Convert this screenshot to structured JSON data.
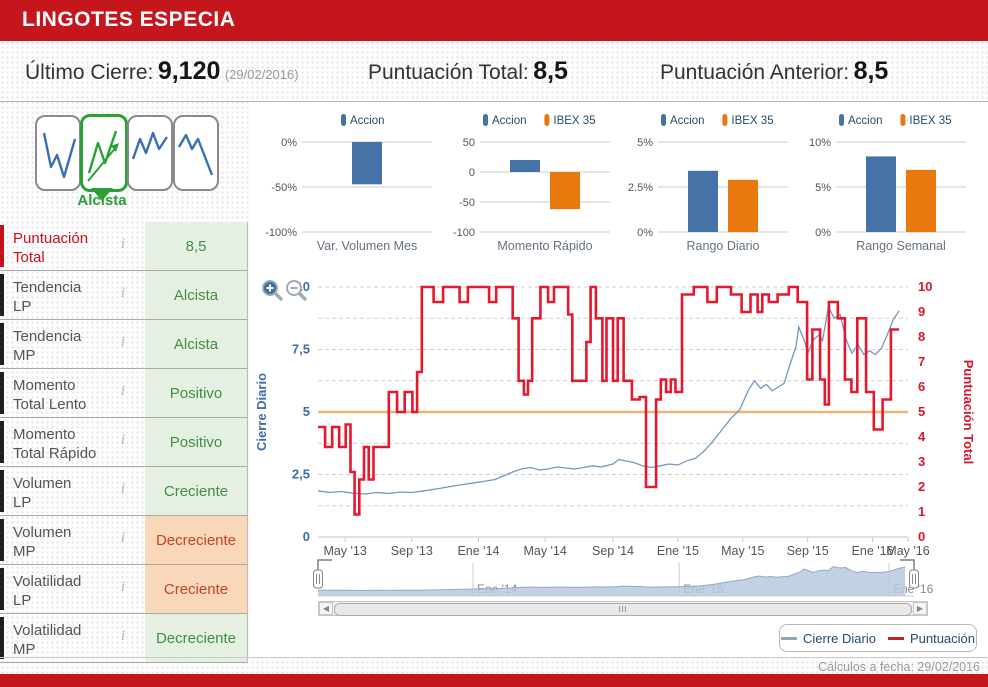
{
  "header": {
    "title": "LINGOTES ESPECIA"
  },
  "stats": {
    "last_close": {
      "label": "Último Cierre:",
      "value": "9,120",
      "date": "(29/02/2016)"
    },
    "score_total": {
      "label": "Puntuación Total:",
      "value": "8,5"
    },
    "score_prev": {
      "label": "Puntuación Anterior:",
      "value": "8,5"
    }
  },
  "colors": {
    "accent_red": "#c4161c",
    "bar_blue": "#4572a7",
    "bar_orange": "#e8790d",
    "series_blue": "#7596bd",
    "series_red": "#e6182e",
    "threshold_orange": "#f0b377",
    "good_bg": "#e6f0e2",
    "good_text": "#3e9044",
    "bad_bg": "#f9d8ba",
    "bad_text": "#c6402c",
    "axis_blue": "#3c6da8",
    "axis_red": "#d6182b",
    "legend_text": "#274b6d"
  },
  "trend_selector": {
    "selected_label": "Alcista",
    "icons": [
      {
        "name": "bajista",
        "selected": false
      },
      {
        "name": "alcista",
        "selected": true
      },
      {
        "name": "lateral-alcista",
        "selected": false
      },
      {
        "name": "lateral-bajista",
        "selected": false
      }
    ]
  },
  "indicators": [
    {
      "line1": "Puntuación",
      "line2": "Total",
      "value": "8,5",
      "state": "good",
      "highlight": true
    },
    {
      "line1": "Tendencia",
      "line2": "LP",
      "value": "Alcista",
      "state": "good"
    },
    {
      "line1": "Tendencia",
      "line2": "MP",
      "value": "Alcista",
      "state": "good"
    },
    {
      "line1": "Momento",
      "line2": "Total Lento",
      "value": "Positivo",
      "state": "good"
    },
    {
      "line1": "Momento",
      "line2": "Total Rápido",
      "value": "Positivo",
      "state": "good"
    },
    {
      "line1": "Volumen",
      "line2": "LP",
      "value": "Creciente",
      "state": "good"
    },
    {
      "line1": "Volumen",
      "line2": "MP",
      "value": "Decreciente",
      "state": "bad"
    },
    {
      "line1": "Volatilidad",
      "line2": "LP",
      "value": "Creciente",
      "state": "bad"
    },
    {
      "line1": "Volatilidad",
      "line2": "MP",
      "value": "Decreciente",
      "state": "good"
    }
  ],
  "chart_data": [
    {
      "type": "bar",
      "title": "Var. Volumen Mes",
      "ymax": 0,
      "ymin": -100,
      "yticks": [
        {
          "label": "0%",
          "v": 0
        },
        {
          "label": "-50%",
          "v": -50
        },
        {
          "label": "-100%",
          "v": -100
        }
      ],
      "series": [
        {
          "name": "Accion",
          "value": -47
        }
      ]
    },
    {
      "type": "bar",
      "title": "Momento Rápido",
      "ymax": 50,
      "ymin": -100,
      "yticks": [
        {
          "label": "50",
          "v": 50
        },
        {
          "label": "0",
          "v": 0
        },
        {
          "label": "-50",
          "v": -50
        },
        {
          "label": "-100",
          "v": -100
        }
      ],
      "series": [
        {
          "name": "Accion",
          "value": 20
        },
        {
          "name": "IBEX 35",
          "value": -62
        }
      ]
    },
    {
      "type": "bar",
      "title": "Rango Diario",
      "ymax": 5,
      "ymin": 0,
      "yticks": [
        {
          "label": "5%",
          "v": 5
        },
        {
          "label": "2.5%",
          "v": 2.5
        },
        {
          "label": "0%",
          "v": 0
        }
      ],
      "series": [
        {
          "name": "Accion",
          "value": 3.4
        },
        {
          "name": "IBEX 35",
          "value": 2.9
        }
      ]
    },
    {
      "type": "bar",
      "title": "Rango Semanal",
      "ymax": 10,
      "ymin": 0,
      "yticks": [
        {
          "label": "10%",
          "v": 10
        },
        {
          "label": "5%",
          "v": 5
        },
        {
          "label": "0%",
          "v": 0
        }
      ],
      "series": [
        {
          "name": "Accion",
          "value": 8.4
        },
        {
          "name": "IBEX 35",
          "value": 6.9
        }
      ]
    },
    {
      "type": "line",
      "left_axis": {
        "title": "Cierre Diario",
        "ticks": [
          {
            "label": "0",
            "v": 0
          },
          {
            "label": "2,5",
            "v": 2.5
          },
          {
            "label": "5",
            "v": 5
          },
          {
            "label": "7,5",
            "v": 7.5
          },
          {
            "label": "10",
            "v": 10
          }
        ],
        "range": [
          0,
          10
        ]
      },
      "right_axis": {
        "title": "Puntuación Total",
        "ticks": [
          "0",
          "1",
          "2",
          "3",
          "4",
          "5",
          "6",
          "7",
          "8",
          "9",
          "10"
        ],
        "range": [
          0,
          10
        ]
      },
      "x_ticks": [
        {
          "label": "May '13",
          "f": 0.046
        },
        {
          "label": "Sep '13",
          "f": 0.159
        },
        {
          "label": "Ene '14",
          "f": 0.272
        },
        {
          "label": "May '14",
          "f": 0.385
        },
        {
          "label": "Sep '14",
          "f": 0.5
        },
        {
          "label": "Ene '15",
          "f": 0.61
        },
        {
          "label": "May '15",
          "f": 0.72
        },
        {
          "label": "Sep '15",
          "f": 0.83
        },
        {
          "label": "Ene '16",
          "f": 0.94
        },
        {
          "label": "May '16",
          "f": 1.0
        }
      ],
      "threshold": 5,
      "series": [
        {
          "name": "Cierre Diario",
          "kind": "line",
          "points": [
            [
              0,
              1.85
            ],
            [
              0.02,
              1.78
            ],
            [
              0.04,
              1.82
            ],
            [
              0.06,
              1.75
            ],
            [
              0.08,
              1.72
            ],
            [
              0.1,
              1.78
            ],
            [
              0.12,
              1.74
            ],
            [
              0.14,
              1.8
            ],
            [
              0.16,
              1.78
            ],
            [
              0.18,
              1.85
            ],
            [
              0.2,
              1.92
            ],
            [
              0.22,
              2.0
            ],
            [
              0.24,
              2.08
            ],
            [
              0.26,
              2.15
            ],
            [
              0.28,
              2.22
            ],
            [
              0.3,
              2.3
            ],
            [
              0.315,
              2.45
            ],
            [
              0.33,
              2.6
            ],
            [
              0.345,
              2.72
            ],
            [
              0.36,
              2.78
            ],
            [
              0.375,
              2.68
            ],
            [
              0.39,
              2.72
            ],
            [
              0.405,
              2.8
            ],
            [
              0.42,
              2.76
            ],
            [
              0.435,
              2.72
            ],
            [
              0.45,
              2.78
            ],
            [
              0.465,
              2.85
            ],
            [
              0.48,
              2.8
            ],
            [
              0.5,
              2.92
            ],
            [
              0.51,
              3.1
            ],
            [
              0.52,
              3.05
            ],
            [
              0.535,
              2.98
            ],
            [
              0.55,
              2.85
            ],
            [
              0.565,
              2.78
            ],
            [
              0.58,
              2.85
            ],
            [
              0.595,
              2.92
            ],
            [
              0.61,
              2.88
            ],
            [
              0.625,
              3.05
            ],
            [
              0.64,
              3.15
            ],
            [
              0.655,
              3.45
            ],
            [
              0.67,
              3.85
            ],
            [
              0.685,
              4.3
            ],
            [
              0.7,
              4.75
            ],
            [
              0.715,
              5.1
            ],
            [
              0.73,
              5.9
            ],
            [
              0.74,
              6.25
            ],
            [
              0.75,
              5.95
            ],
            [
              0.76,
              6.1
            ],
            [
              0.77,
              5.85
            ],
            [
              0.78,
              6.0
            ],
            [
              0.79,
              6.15
            ],
            [
              0.8,
              6.9
            ],
            [
              0.81,
              7.6
            ],
            [
              0.815,
              8.4
            ],
            [
              0.825,
              7.8
            ],
            [
              0.83,
              7.35
            ],
            [
              0.84,
              7.9
            ],
            [
              0.85,
              8.1
            ],
            [
              0.855,
              7.85
            ],
            [
              0.865,
              9.2
            ],
            [
              0.875,
              8.75
            ],
            [
              0.885,
              8.9
            ],
            [
              0.895,
              7.9
            ],
            [
              0.905,
              7.35
            ],
            [
              0.915,
              7.7
            ],
            [
              0.925,
              7.3
            ],
            [
              0.935,
              7.45
            ],
            [
              0.945,
              7.3
            ],
            [
              0.955,
              7.55
            ],
            [
              0.965,
              8.1
            ],
            [
              0.975,
              8.7
            ],
            [
              0.985,
              9.05
            ]
          ]
        },
        {
          "name": "Puntuación",
          "kind": "step",
          "points": [
            [
              0.0,
              4.4
            ],
            [
              0.012,
              3.6
            ],
            [
              0.024,
              4.4
            ],
            [
              0.036,
              3.6
            ],
            [
              0.047,
              4.5
            ],
            [
              0.055,
              2.6
            ],
            [
              0.062,
              0.9
            ],
            [
              0.07,
              2.3
            ],
            [
              0.078,
              3.6
            ],
            [
              0.086,
              2.3
            ],
            [
              0.094,
              3.6
            ],
            [
              0.12,
              5.8
            ],
            [
              0.134,
              5.0
            ],
            [
              0.147,
              5.8
            ],
            [
              0.16,
              5.0
            ],
            [
              0.168,
              6.6
            ],
            [
              0.176,
              10
            ],
            [
              0.196,
              9.4
            ],
            [
              0.212,
              10
            ],
            [
              0.24,
              9.4
            ],
            [
              0.254,
              10
            ],
            [
              0.29,
              9.4
            ],
            [
              0.302,
              10
            ],
            [
              0.33,
              8.75
            ],
            [
              0.34,
              6.25
            ],
            [
              0.349,
              5.7
            ],
            [
              0.356,
              6.25
            ],
            [
              0.363,
              8.75
            ],
            [
              0.377,
              10
            ],
            [
              0.39,
              9.4
            ],
            [
              0.4,
              10
            ],
            [
              0.424,
              8.9
            ],
            [
              0.431,
              6.25
            ],
            [
              0.455,
              7.8
            ],
            [
              0.462,
              10
            ],
            [
              0.471,
              8.75
            ],
            [
              0.482,
              6.25
            ],
            [
              0.489,
              8.75
            ],
            [
              0.5,
              6.25
            ],
            [
              0.508,
              8.75
            ],
            [
              0.518,
              6.25
            ],
            [
              0.532,
              5.5
            ],
            [
              0.545,
              5.6
            ],
            [
              0.556,
              2.0
            ],
            [
              0.573,
              5.5
            ],
            [
              0.581,
              6.3
            ],
            [
              0.59,
              5.8
            ],
            [
              0.598,
              6.3
            ],
            [
              0.606,
              5.8
            ],
            [
              0.617,
              9.7
            ],
            [
              0.637,
              10
            ],
            [
              0.66,
              9.4
            ],
            [
              0.676,
              10
            ],
            [
              0.7,
              9.7
            ],
            [
              0.718,
              9.0
            ],
            [
              0.733,
              9.7
            ],
            [
              0.745,
              9.0
            ],
            [
              0.753,
              9.7
            ],
            [
              0.764,
              9.4
            ],
            [
              0.779,
              9.7
            ],
            [
              0.798,
              10
            ],
            [
              0.813,
              9.4
            ],
            [
              0.829,
              6.3
            ],
            [
              0.838,
              8.3
            ],
            [
              0.851,
              6.3
            ],
            [
              0.859,
              5.3
            ],
            [
              0.866,
              9.4
            ],
            [
              0.881,
              8.75
            ],
            [
              0.893,
              6.3
            ],
            [
              0.904,
              5.8
            ],
            [
              0.914,
              8.75
            ],
            [
              0.929,
              5.8
            ],
            [
              0.942,
              4.3
            ],
            [
              0.957,
              5.5
            ],
            [
              0.971,
              8.3
            ],
            [
              0.985,
              8.3
            ]
          ]
        }
      ],
      "navigator": {
        "labels": [
          {
            "label": "Ene '14",
            "f": 0.26
          },
          {
            "label": "Ene '15",
            "f": 0.606
          },
          {
            "label": "Ene '16",
            "f": 0.958
          }
        ]
      }
    }
  ],
  "main_legend": [
    {
      "label": "Cierre Diario",
      "color": "#8fa8bd"
    },
    {
      "label": "Puntuación",
      "color": "#c21f2f"
    }
  ],
  "footer": {
    "text": "Cálculos a fecha: 29/02/2016"
  }
}
